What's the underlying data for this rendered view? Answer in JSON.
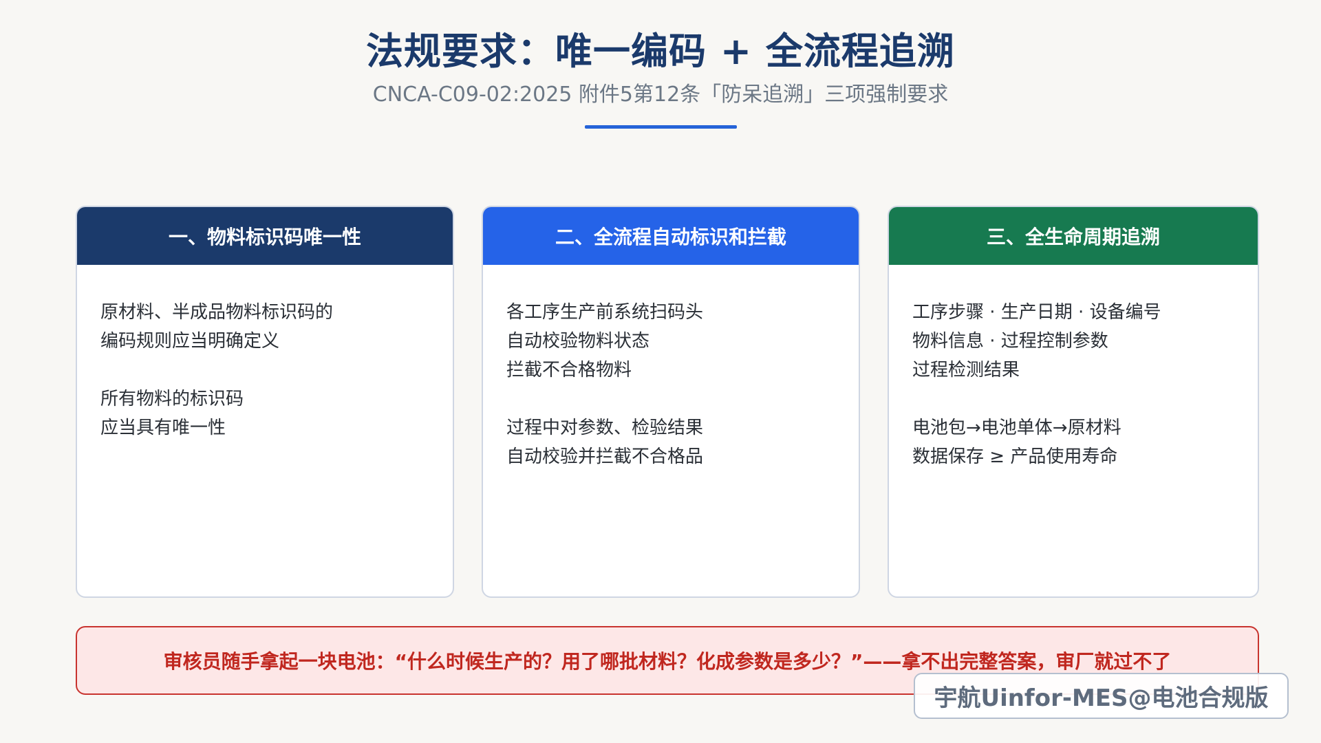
{
  "header": {
    "title": "法规要求：唯一编码 + 全流程追溯",
    "subtitle": "CNCA-C09-02:2025 附件5第12条「防呆追溯」三项强制要求",
    "accent_color": "#2563d8"
  },
  "cards": [
    {
      "title": "一、物料标识码唯一性",
      "header_color": "#1b3a6b",
      "paragraphs": [
        [
          "原材料、半成品物料标识码的",
          "编码规则应当明确定义"
        ],
        [
          "所有物料的标识码",
          "应当具有唯一性"
        ]
      ]
    },
    {
      "title": "二、全流程自动标识和拦截",
      "header_color": "#2563e8",
      "paragraphs": [
        [
          "各工序生产前系统扫码头",
          "自动校验物料状态",
          "拦截不合格物料"
        ],
        [
          "过程中对参数、检验结果",
          "自动校验并拦截不合格品"
        ]
      ]
    },
    {
      "title": "三、全生命周期追溯",
      "header_color": "#177a50",
      "paragraphs": [
        [
          "工序步骤 · 生产日期 · 设备编号",
          "物料信息 · 过程控制参数",
          "过程检测结果"
        ],
        [
          "电池包→电池单体→原材料",
          "数据保存 ≥ 产品使用寿命"
        ]
      ]
    }
  ],
  "alert": {
    "text": "审核员随手拿起一块电池：“什么时候生产的？用了哪批材料？化成参数是多少？”——拿不出完整答案，审厂就过不了",
    "color": "#c0271f"
  },
  "watermark": {
    "text": "宇航Uinfor-MES@电池合规版"
  }
}
